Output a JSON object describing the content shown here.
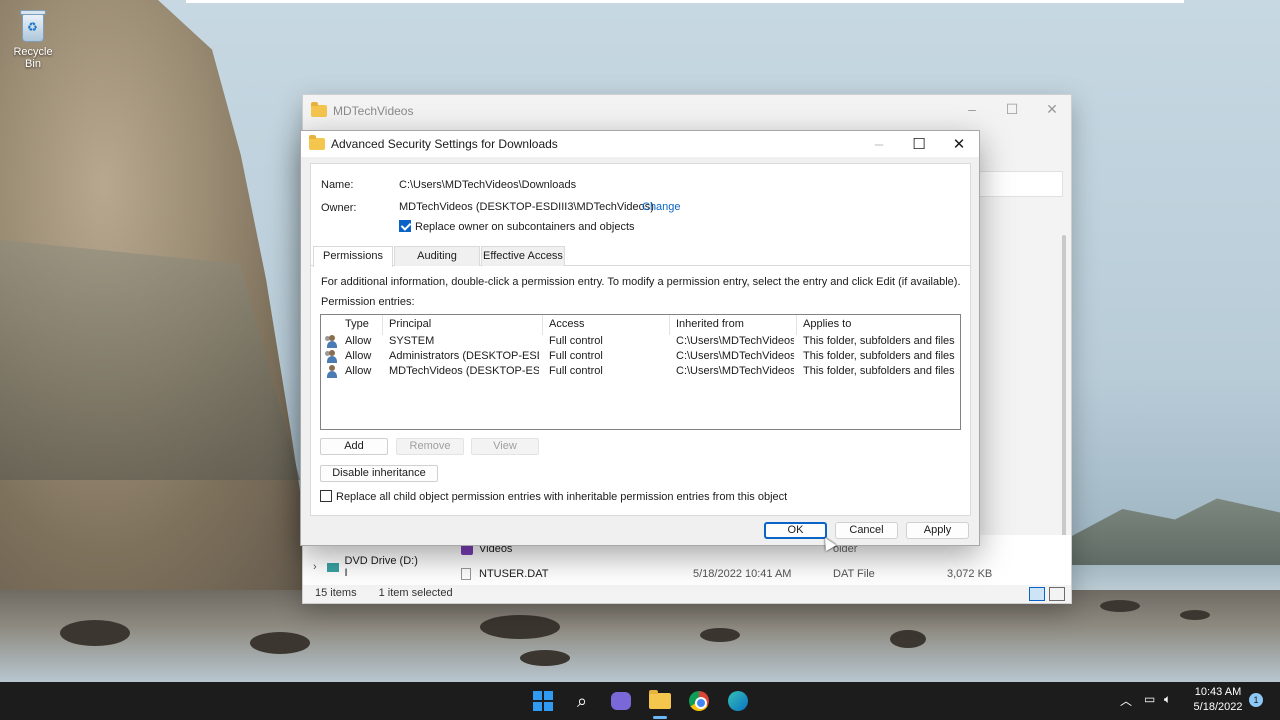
{
  "desktop": {
    "recycle_bin_label": "Recycle Bin"
  },
  "explorer": {
    "title": "MDTechVideos",
    "rows": [
      {
        "name": "Videos",
        "date": "",
        "type": "older",
        "size": ""
      },
      {
        "name": "NTUSER.DAT",
        "date": "5/18/2022 10:41 AM",
        "type": "DAT File",
        "size": "3,072 KB"
      }
    ],
    "nav_dvd": "DVD Drive (D:) I",
    "status_items": "15 items",
    "status_selected": "1 item selected"
  },
  "dialog": {
    "title": "Advanced Security Settings for Downloads",
    "name_label": "Name:",
    "name_value": "C:\\Users\\MDTechVideos\\Downloads",
    "owner_label": "Owner:",
    "owner_value": "MDTechVideos (DESKTOP-ESDIII3\\MDTechVideos)",
    "change_link": "Change",
    "replace_owner_label": "Replace owner on subcontainers and objects",
    "tabs": [
      "Permissions",
      "Auditing",
      "Effective Access"
    ],
    "info_text": "For additional information, double-click a permission entry. To modify a permission entry, select the entry and click Edit (if available).",
    "entries_label": "Permission entries:",
    "columns": [
      "Type",
      "Principal",
      "Access",
      "Inherited from",
      "Applies to"
    ],
    "entries": [
      {
        "type": "Allow",
        "principal": "SYSTEM",
        "access": "Full control",
        "inherited": "C:\\Users\\MDTechVideos\\",
        "applies": "This folder, subfolders and files"
      },
      {
        "type": "Allow",
        "principal": "Administrators (DESKTOP-ESD...",
        "access": "Full control",
        "inherited": "C:\\Users\\MDTechVideos\\",
        "applies": "This folder, subfolders and files"
      },
      {
        "type": "Allow",
        "principal": "MDTechVideos (DESKTOP-ESD...",
        "access": "Full control",
        "inherited": "C:\\Users\\MDTechVideos\\",
        "applies": "This folder, subfolders and files"
      }
    ],
    "add_label": "Add",
    "remove_label": "Remove",
    "view_label": "View",
    "disable_inheritance_label": "Disable inheritance",
    "replace_child_label": "Replace all child object permission entries with inheritable permission entries from this object",
    "ok_label": "OK",
    "cancel_label": "Cancel",
    "apply_label": "Apply"
  },
  "taskbar": {
    "time": "10:43 AM",
    "date": "5/18/2022",
    "notification_count": "1"
  }
}
